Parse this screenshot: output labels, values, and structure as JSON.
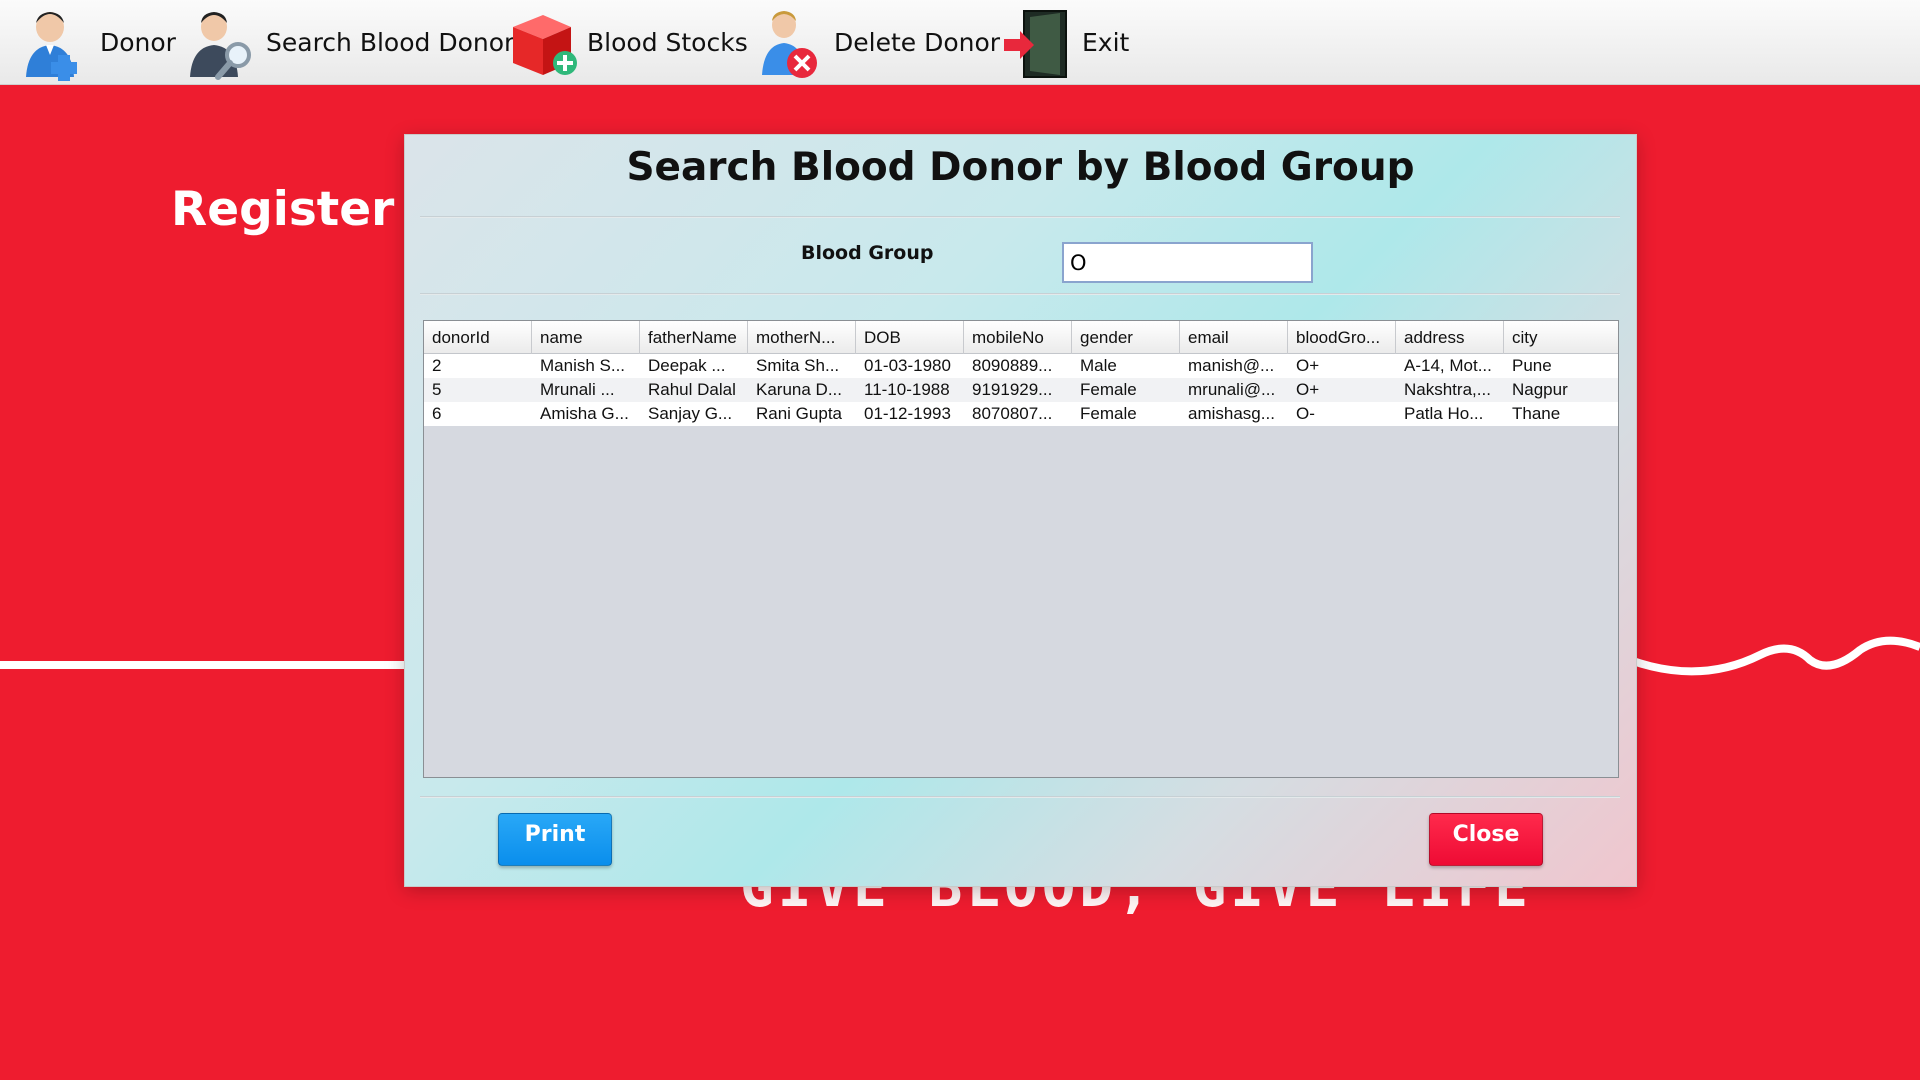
{
  "menu": {
    "items": [
      {
        "label": "Donor",
        "icon": "add-user-icon"
      },
      {
        "label": "Search Blood Donor",
        "icon": "search-user-icon"
      },
      {
        "label": "Blood Stocks",
        "icon": "blood-stock-icon"
      },
      {
        "label": "Delete Donor",
        "icon": "delete-user-icon"
      },
      {
        "label": "Exit",
        "icon": "exit-door-icon"
      }
    ]
  },
  "background": {
    "heading": "Register fo",
    "slogan": "GIVE BLOOD, GIVE LIFE",
    "color": "#ee1c2f"
  },
  "dialog": {
    "title": "Search Blood Donor by Blood Group",
    "blood_group_label": "Blood Group",
    "blood_group_value": "O",
    "columns": [
      "donorId",
      "name",
      "fatherName",
      "motherN...",
      "DOB",
      "mobileNo",
      "gender",
      "email",
      "bloodGro...",
      "address",
      "city"
    ],
    "rows": [
      [
        "2",
        "Manish S...",
        "Deepak ...",
        "Smita Sh...",
        "01-03-1980",
        "8090889...",
        "Male",
        "manish@...",
        "O+",
        "A-14, Mot...",
        "Pune"
      ],
      [
        "5",
        "Mrunali ...",
        "Rahul Dalal",
        "Karuna D...",
        "11-10-1988",
        "9191929...",
        "Female",
        "mrunali@...",
        "O+",
        "Nakshtra,...",
        "Nagpur"
      ],
      [
        "6",
        "Amisha G...",
        "Sanjay G...",
        "Rani Gupta",
        "01-12-1993",
        "8070807...",
        "Female",
        "amishasg...",
        "O-",
        "Patla Ho...",
        "Thane"
      ]
    ],
    "print_label": "Print",
    "close_label": "Close",
    "print_color": "#0a8eec",
    "close_color": "#ee0b34"
  }
}
